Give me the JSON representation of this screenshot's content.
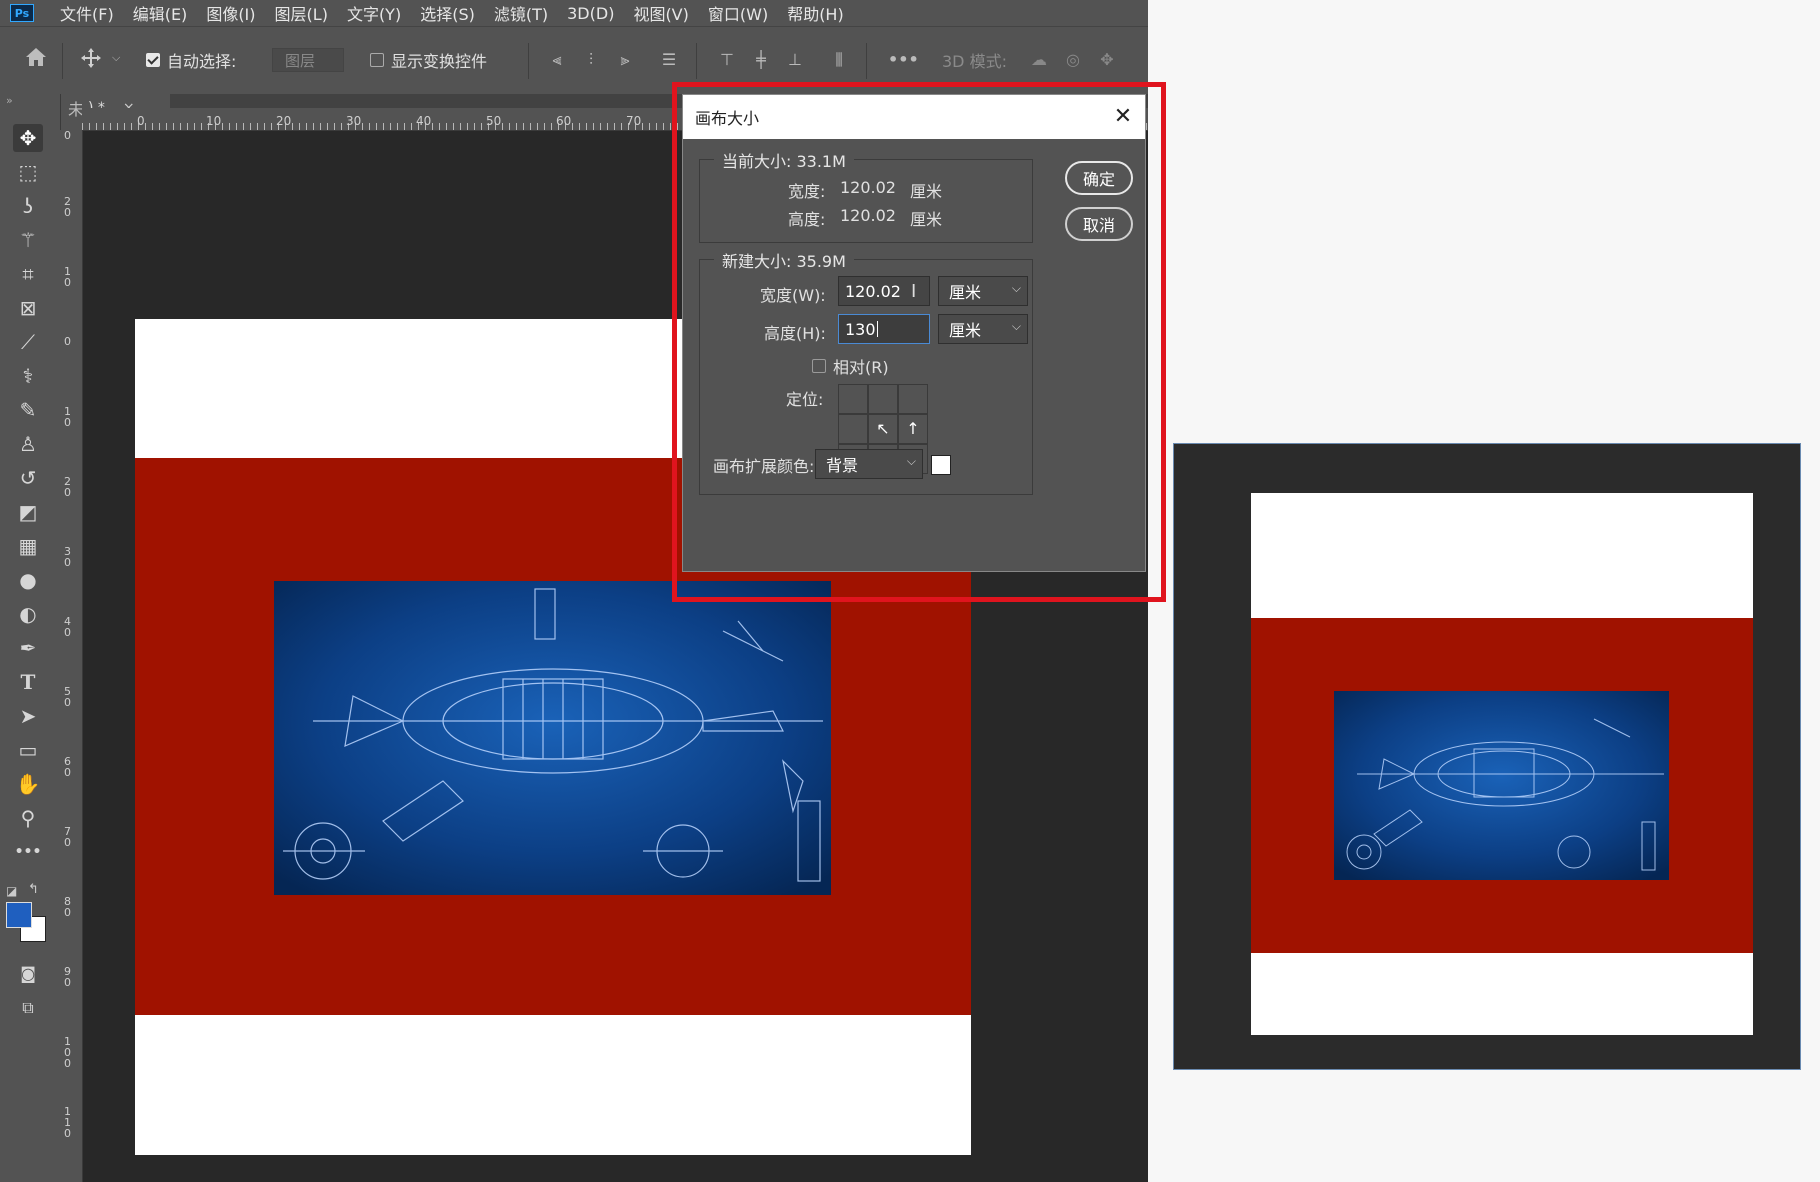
{
  "app": {
    "logo": "Ps",
    "menu": [
      "文件(F)",
      "编辑(E)",
      "图像(I)",
      "图层(L)",
      "文字(Y)",
      "选择(S)",
      "滤镜(T)",
      "3D(D)",
      "视图(V)",
      "窗口(W)",
      "帮助(H)"
    ]
  },
  "options": {
    "auto_select_label": "自动选择:",
    "auto_select_value": "图层",
    "transform_controls_label": "显示变换控件",
    "more": "•••",
    "mode_3d_label": "3D 模式:"
  },
  "document": {
    "tab_label": ") *",
    "tab_close": "×",
    "tab_partial": "未",
    "ruler_h": [
      "0",
      "10",
      "20",
      "30",
      "40",
      "50",
      "60",
      "70"
    ],
    "ruler_v": [
      "0",
      "20",
      "10",
      "0",
      "10",
      "20",
      "30",
      "40",
      "50",
      "60",
      "70",
      "80",
      "90",
      "100",
      "110"
    ]
  },
  "dialog": {
    "title": "画布大小",
    "current_size_label": "当前大小: 33.1M",
    "current_width_label": "宽度:",
    "current_width_value": "120.02",
    "current_width_unit": "厘米",
    "current_height_label": "高度:",
    "current_height_value": "120.02",
    "current_height_unit": "厘米",
    "new_size_label": "新建大小: 35.9M",
    "width_label": "宽度(W):",
    "width_value": "120.02",
    "width_unit": "厘米",
    "height_label": "高度(H):",
    "height_value": "130",
    "height_unit": "厘米",
    "relative_label": "相对(R)",
    "anchor_label": "定位:",
    "anchor_arrows": {
      "up": "↑",
      "up_left": "↖",
      "left": "←",
      "center": "●"
    },
    "extension_color_label": "画布扩展颜色:",
    "extension_color_value": "背景",
    "extension_swatch": "#ffffff",
    "ok_button": "确定",
    "cancel_button": "取消"
  },
  "colors": {
    "red_band": "#a01200",
    "highlight": "#e0141e",
    "foreground": "#1f5fbf",
    "background": "#ffffff",
    "blueprint": "#0a3a7a"
  }
}
